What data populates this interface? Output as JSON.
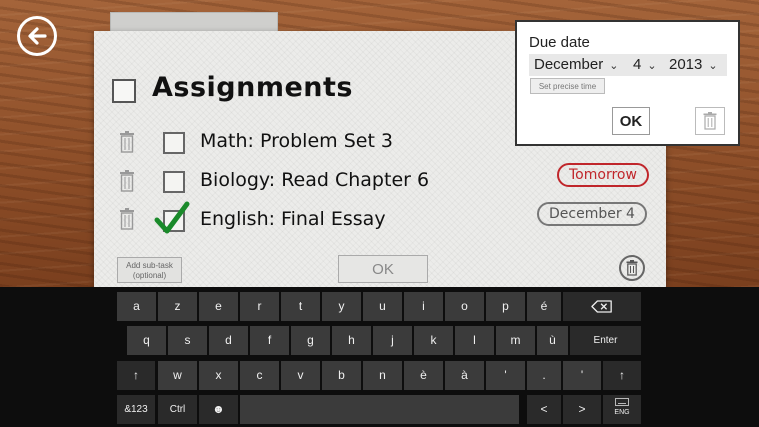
{
  "header": {
    "back_icon": "arrow-left-icon"
  },
  "card": {
    "title": "Assignments",
    "tasks": [
      {
        "label": "Math: Problem Set 3",
        "checked": false
      },
      {
        "label": "Biology: Read Chapter 6",
        "checked": false,
        "due": "Tomorrow"
      },
      {
        "label": "English: Final Essay",
        "checked": true,
        "due": "December 4"
      }
    ],
    "add_subtask_line1": "Add sub-task",
    "add_subtask_line2": "(optional)",
    "ok_label": "OK",
    "colors": {
      "due_soon": "#c0262b",
      "check_green": "#1a8a2a"
    }
  },
  "due_popup": {
    "title": "Due date",
    "month": "December",
    "day": "4",
    "year": "2013",
    "precise_label": "Set precise time",
    "ok_label": "OK"
  },
  "keyboard": {
    "row1": [
      "a",
      "z",
      "e",
      "r",
      "t",
      "y",
      "u",
      "i",
      "o",
      "p",
      "é"
    ],
    "row2": [
      "q",
      "s",
      "d",
      "f",
      "g",
      "h",
      "j",
      "k",
      "l",
      "m",
      "ù"
    ],
    "row3": [
      "w",
      "x",
      "c",
      "v",
      "b",
      "n",
      "è",
      "à",
      "'"
    ],
    "enter": "Enter",
    "shift": "↑",
    "symbols": "&123",
    "ctrl": "Ctrl",
    "emoji": "☻",
    "left": "<",
    "right": ">",
    "lang": "ENG",
    "period": "."
  }
}
